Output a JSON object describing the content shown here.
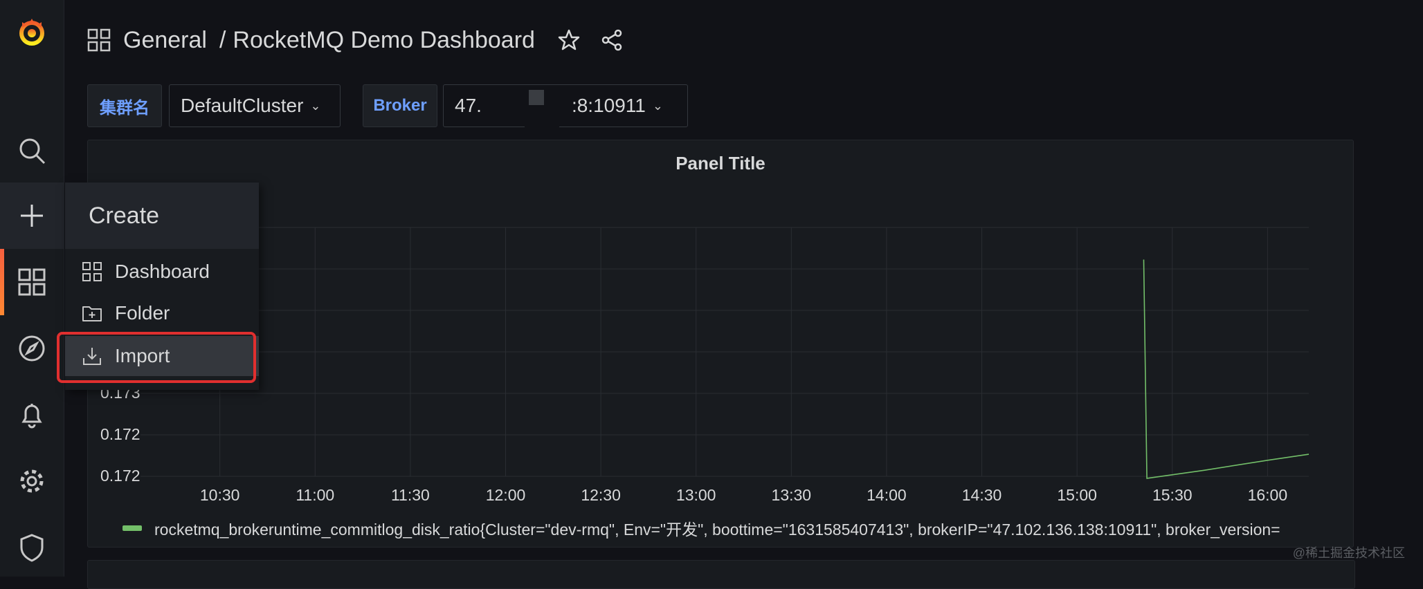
{
  "header": {
    "breadcrumb_folder": "General",
    "breadcrumb_sep": "/",
    "dashboard_title": "RocketMQ Demo Dashboard"
  },
  "variables": {
    "cluster_label": "集群名",
    "cluster_value": "DefaultCluster",
    "broker_label": "Broker",
    "broker_value_prefix": "47.",
    "broker_value_suffix": ":8:10911"
  },
  "create_menu": {
    "title": "Create",
    "items": [
      {
        "label": "Dashboard",
        "icon": "apps-icon"
      },
      {
        "label": "Folder",
        "icon": "folder-plus-icon"
      },
      {
        "label": "Import",
        "icon": "import-icon"
      }
    ],
    "selected": "Import"
  },
  "panel": {
    "title": "Panel Title",
    "visible_y_ticks": [
      "0.173",
      "0.172",
      "0.172"
    ]
  },
  "chart_data": {
    "type": "line",
    "title": "Panel Title",
    "x_ticks": [
      "10:30",
      "11:00",
      "11:30",
      "12:00",
      "12:30",
      "13:00",
      "13:30",
      "14:00",
      "14:30",
      "15:00",
      "15:30",
      "16:00"
    ],
    "series": [
      {
        "name": "rocketmq_brokeruntime_commitlog_disk_ratio{Cluster=\"dev-rmq\", Env=\"开发\", boottime=\"1631585407413\", brokerIP=\"47.102.136.138:10911\", broker_version=",
        "color": "#73bf69",
        "points": [
          {
            "t": "15:21",
            "v": 0.177
          },
          {
            "t": "15:22",
            "v": 0.17155
          },
          {
            "t": "15:40",
            "v": 0.17175
          },
          {
            "t": "16:00",
            "v": 0.172
          },
          {
            "t": "16:13",
            "v": 0.17215
          }
        ]
      }
    ],
    "ylim": [
      0.1716,
      0.1778
    ],
    "grid": true,
    "legend": "bottom-left"
  },
  "sidebar": {
    "items": [
      {
        "name": "grafana-logo-icon"
      },
      {
        "name": "search-icon"
      },
      {
        "name": "plus-icon"
      },
      {
        "name": "apps-icon"
      },
      {
        "name": "compass-icon"
      },
      {
        "name": "bell-icon"
      },
      {
        "name": "gear-icon"
      },
      {
        "name": "shield-icon"
      }
    ]
  },
  "watermark": "@稀土掘金技术社区",
  "colors": {
    "background": "#111217",
    "panel": "#181b1f",
    "accent": "#f55f3e",
    "series": "#73bf69",
    "variable_label": "#6e9fff",
    "highlight": "#e02f2f"
  }
}
